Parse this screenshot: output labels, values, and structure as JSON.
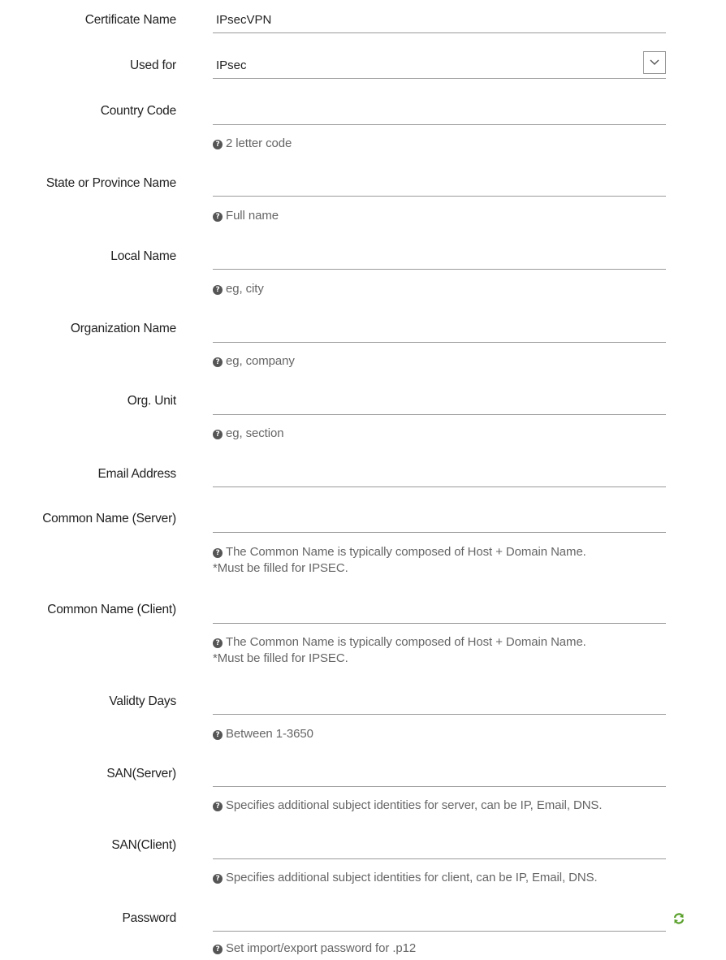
{
  "fields": {
    "certificate_name": {
      "label": "Certificate Name",
      "value": "IPsecVPN"
    },
    "used_for": {
      "label": "Used for",
      "value": "IPsec"
    },
    "country_code": {
      "label": "Country Code",
      "help": "2 letter code"
    },
    "state": {
      "label": "State or Province Name",
      "help": "Full name"
    },
    "local_name": {
      "label": "Local Name",
      "help": "eg, city"
    },
    "org_name": {
      "label": "Organization Name",
      "help": "eg, company"
    },
    "org_unit": {
      "label": "Org. Unit",
      "help": "eg, section"
    },
    "email": {
      "label": "Email Address"
    },
    "cn_server": {
      "label": "Common Name (Server)",
      "help_line1": "The Common Name is typically composed of Host + Domain Name.",
      "help_line2": "*Must be filled for IPSEC."
    },
    "cn_client": {
      "label": "Common Name (Client)",
      "help_line1": "The Common Name is typically composed of Host + Domain Name.",
      "help_line2": "*Must be filled for IPSEC."
    },
    "validity": {
      "label": "Validty Days",
      "help": "Between 1-3650"
    },
    "san_server": {
      "label": "SAN(Server)",
      "help": "Specifies additional subject identities for server, can be IP, Email, DNS."
    },
    "san_client": {
      "label": "SAN(Client)",
      "help": "Specifies additional subject identities for client, can be IP, Email, DNS."
    },
    "password": {
      "label": "Password",
      "help": "Set import/export password for .p12"
    }
  },
  "icons": {
    "help": "question-circle-icon",
    "dropdown": "chevron-down-icon",
    "refresh": "refresh-icon"
  },
  "colors": {
    "refresh_icon": "#5aa02c",
    "help_text": "#666666",
    "underline": "#9a9a9a"
  }
}
